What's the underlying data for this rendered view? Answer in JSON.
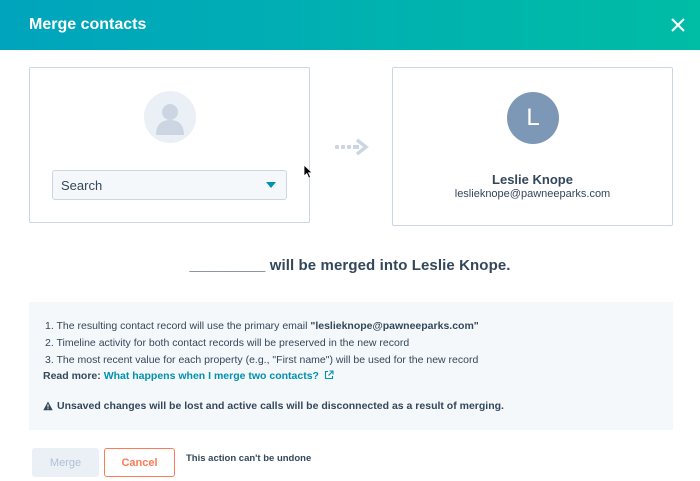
{
  "dialog": {
    "title": "Merge contacts",
    "close_icon": "close-icon"
  },
  "left_card": {
    "avatar_icon": "person-placeholder-icon",
    "search": {
      "value": "Search",
      "icon": "chevron-down-icon"
    }
  },
  "arrow_icon": "dotted-arrow-right-icon",
  "right_card": {
    "avatar_initial": "L",
    "name": "Leslie Knope",
    "email": "leslieknope@pawneeparks.com"
  },
  "merge_sentence": "_________ will be merged into Leslie Knope.",
  "info": {
    "items": [
      {
        "prefix": "1. The resulting contact record will use the primary email ",
        "bold": "\"leslieknope@pawneeparks.com\""
      },
      {
        "prefix": "2. Timeline activity for both contact records will be preserved in the new record",
        "bold": ""
      },
      {
        "prefix": "3. The most recent value for each property (e.g., \"First name\") will be used for the new record",
        "bold": ""
      }
    ],
    "read_more_label": "Read more:",
    "read_more_link": "What happens when I merge two contacts?",
    "warning": "Unsaved changes will be lost and active calls will be disconnected as a result of merging."
  },
  "footer": {
    "merge_label": "Merge",
    "cancel_label": "Cancel",
    "undone_text": "This action can't be undone"
  },
  "colors": {
    "header_start": "#00a4bd",
    "header_end": "#00bda5",
    "link": "#0091ae",
    "cancel": "#ff7a59",
    "avatar": "#7c98b6"
  }
}
